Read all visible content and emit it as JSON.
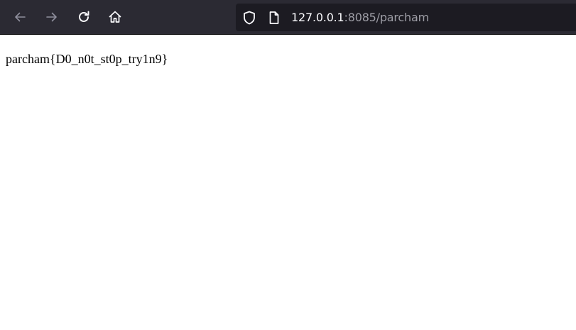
{
  "toolbar": {
    "back_icon": "back-arrow-icon",
    "forward_icon": "forward-arrow-icon",
    "reload_icon": "reload-icon",
    "home_icon": "home-icon"
  },
  "urlbar": {
    "security_icon": "shield-icon",
    "page_icon": "page-icon",
    "host": "127.0.0.1",
    "rest": ":8085/parcham"
  },
  "page": {
    "text": "parcham{D0_n0t_st0p_try1n9}"
  },
  "colors": {
    "toolbar_bg": "#2b2a33",
    "urlbar_bg": "#1c1b22",
    "icon_enabled": "#fbfbfe",
    "icon_disabled": "#8f8f9d",
    "url_host": "#fbfbfe",
    "url_rest": "#9e9ea6",
    "page_bg": "#ffffff",
    "page_text": "#000000"
  }
}
